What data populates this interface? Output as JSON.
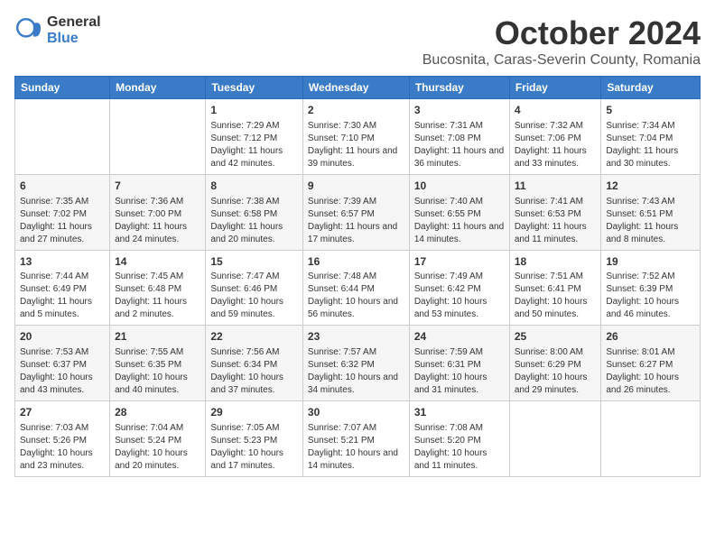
{
  "header": {
    "logo_general": "General",
    "logo_blue": "Blue",
    "month": "October 2024",
    "location": "Bucosnita, Caras-Severin County, Romania"
  },
  "days_of_week": [
    "Sunday",
    "Monday",
    "Tuesday",
    "Wednesday",
    "Thursday",
    "Friday",
    "Saturday"
  ],
  "weeks": [
    [
      {
        "day": "",
        "info": ""
      },
      {
        "day": "",
        "info": ""
      },
      {
        "day": "1",
        "info": "Sunrise: 7:29 AM\nSunset: 7:12 PM\nDaylight: 11 hours and 42 minutes."
      },
      {
        "day": "2",
        "info": "Sunrise: 7:30 AM\nSunset: 7:10 PM\nDaylight: 11 hours and 39 minutes."
      },
      {
        "day": "3",
        "info": "Sunrise: 7:31 AM\nSunset: 7:08 PM\nDaylight: 11 hours and 36 minutes."
      },
      {
        "day": "4",
        "info": "Sunrise: 7:32 AM\nSunset: 7:06 PM\nDaylight: 11 hours and 33 minutes."
      },
      {
        "day": "5",
        "info": "Sunrise: 7:34 AM\nSunset: 7:04 PM\nDaylight: 11 hours and 30 minutes."
      }
    ],
    [
      {
        "day": "6",
        "info": "Sunrise: 7:35 AM\nSunset: 7:02 PM\nDaylight: 11 hours and 27 minutes."
      },
      {
        "day": "7",
        "info": "Sunrise: 7:36 AM\nSunset: 7:00 PM\nDaylight: 11 hours and 24 minutes."
      },
      {
        "day": "8",
        "info": "Sunrise: 7:38 AM\nSunset: 6:58 PM\nDaylight: 11 hours and 20 minutes."
      },
      {
        "day": "9",
        "info": "Sunrise: 7:39 AM\nSunset: 6:57 PM\nDaylight: 11 hours and 17 minutes."
      },
      {
        "day": "10",
        "info": "Sunrise: 7:40 AM\nSunset: 6:55 PM\nDaylight: 11 hours and 14 minutes."
      },
      {
        "day": "11",
        "info": "Sunrise: 7:41 AM\nSunset: 6:53 PM\nDaylight: 11 hours and 11 minutes."
      },
      {
        "day": "12",
        "info": "Sunrise: 7:43 AM\nSunset: 6:51 PM\nDaylight: 11 hours and 8 minutes."
      }
    ],
    [
      {
        "day": "13",
        "info": "Sunrise: 7:44 AM\nSunset: 6:49 PM\nDaylight: 11 hours and 5 minutes."
      },
      {
        "day": "14",
        "info": "Sunrise: 7:45 AM\nSunset: 6:48 PM\nDaylight: 11 hours and 2 minutes."
      },
      {
        "day": "15",
        "info": "Sunrise: 7:47 AM\nSunset: 6:46 PM\nDaylight: 10 hours and 59 minutes."
      },
      {
        "day": "16",
        "info": "Sunrise: 7:48 AM\nSunset: 6:44 PM\nDaylight: 10 hours and 56 minutes."
      },
      {
        "day": "17",
        "info": "Sunrise: 7:49 AM\nSunset: 6:42 PM\nDaylight: 10 hours and 53 minutes."
      },
      {
        "day": "18",
        "info": "Sunrise: 7:51 AM\nSunset: 6:41 PM\nDaylight: 10 hours and 50 minutes."
      },
      {
        "day": "19",
        "info": "Sunrise: 7:52 AM\nSunset: 6:39 PM\nDaylight: 10 hours and 46 minutes."
      }
    ],
    [
      {
        "day": "20",
        "info": "Sunrise: 7:53 AM\nSunset: 6:37 PM\nDaylight: 10 hours and 43 minutes."
      },
      {
        "day": "21",
        "info": "Sunrise: 7:55 AM\nSunset: 6:35 PM\nDaylight: 10 hours and 40 minutes."
      },
      {
        "day": "22",
        "info": "Sunrise: 7:56 AM\nSunset: 6:34 PM\nDaylight: 10 hours and 37 minutes."
      },
      {
        "day": "23",
        "info": "Sunrise: 7:57 AM\nSunset: 6:32 PM\nDaylight: 10 hours and 34 minutes."
      },
      {
        "day": "24",
        "info": "Sunrise: 7:59 AM\nSunset: 6:31 PM\nDaylight: 10 hours and 31 minutes."
      },
      {
        "day": "25",
        "info": "Sunrise: 8:00 AM\nSunset: 6:29 PM\nDaylight: 10 hours and 29 minutes."
      },
      {
        "day": "26",
        "info": "Sunrise: 8:01 AM\nSunset: 6:27 PM\nDaylight: 10 hours and 26 minutes."
      }
    ],
    [
      {
        "day": "27",
        "info": "Sunrise: 7:03 AM\nSunset: 5:26 PM\nDaylight: 10 hours and 23 minutes."
      },
      {
        "day": "28",
        "info": "Sunrise: 7:04 AM\nSunset: 5:24 PM\nDaylight: 10 hours and 20 minutes."
      },
      {
        "day": "29",
        "info": "Sunrise: 7:05 AM\nSunset: 5:23 PM\nDaylight: 10 hours and 17 minutes."
      },
      {
        "day": "30",
        "info": "Sunrise: 7:07 AM\nSunset: 5:21 PM\nDaylight: 10 hours and 14 minutes."
      },
      {
        "day": "31",
        "info": "Sunrise: 7:08 AM\nSunset: 5:20 PM\nDaylight: 10 hours and 11 minutes."
      },
      {
        "day": "",
        "info": ""
      },
      {
        "day": "",
        "info": ""
      }
    ]
  ]
}
